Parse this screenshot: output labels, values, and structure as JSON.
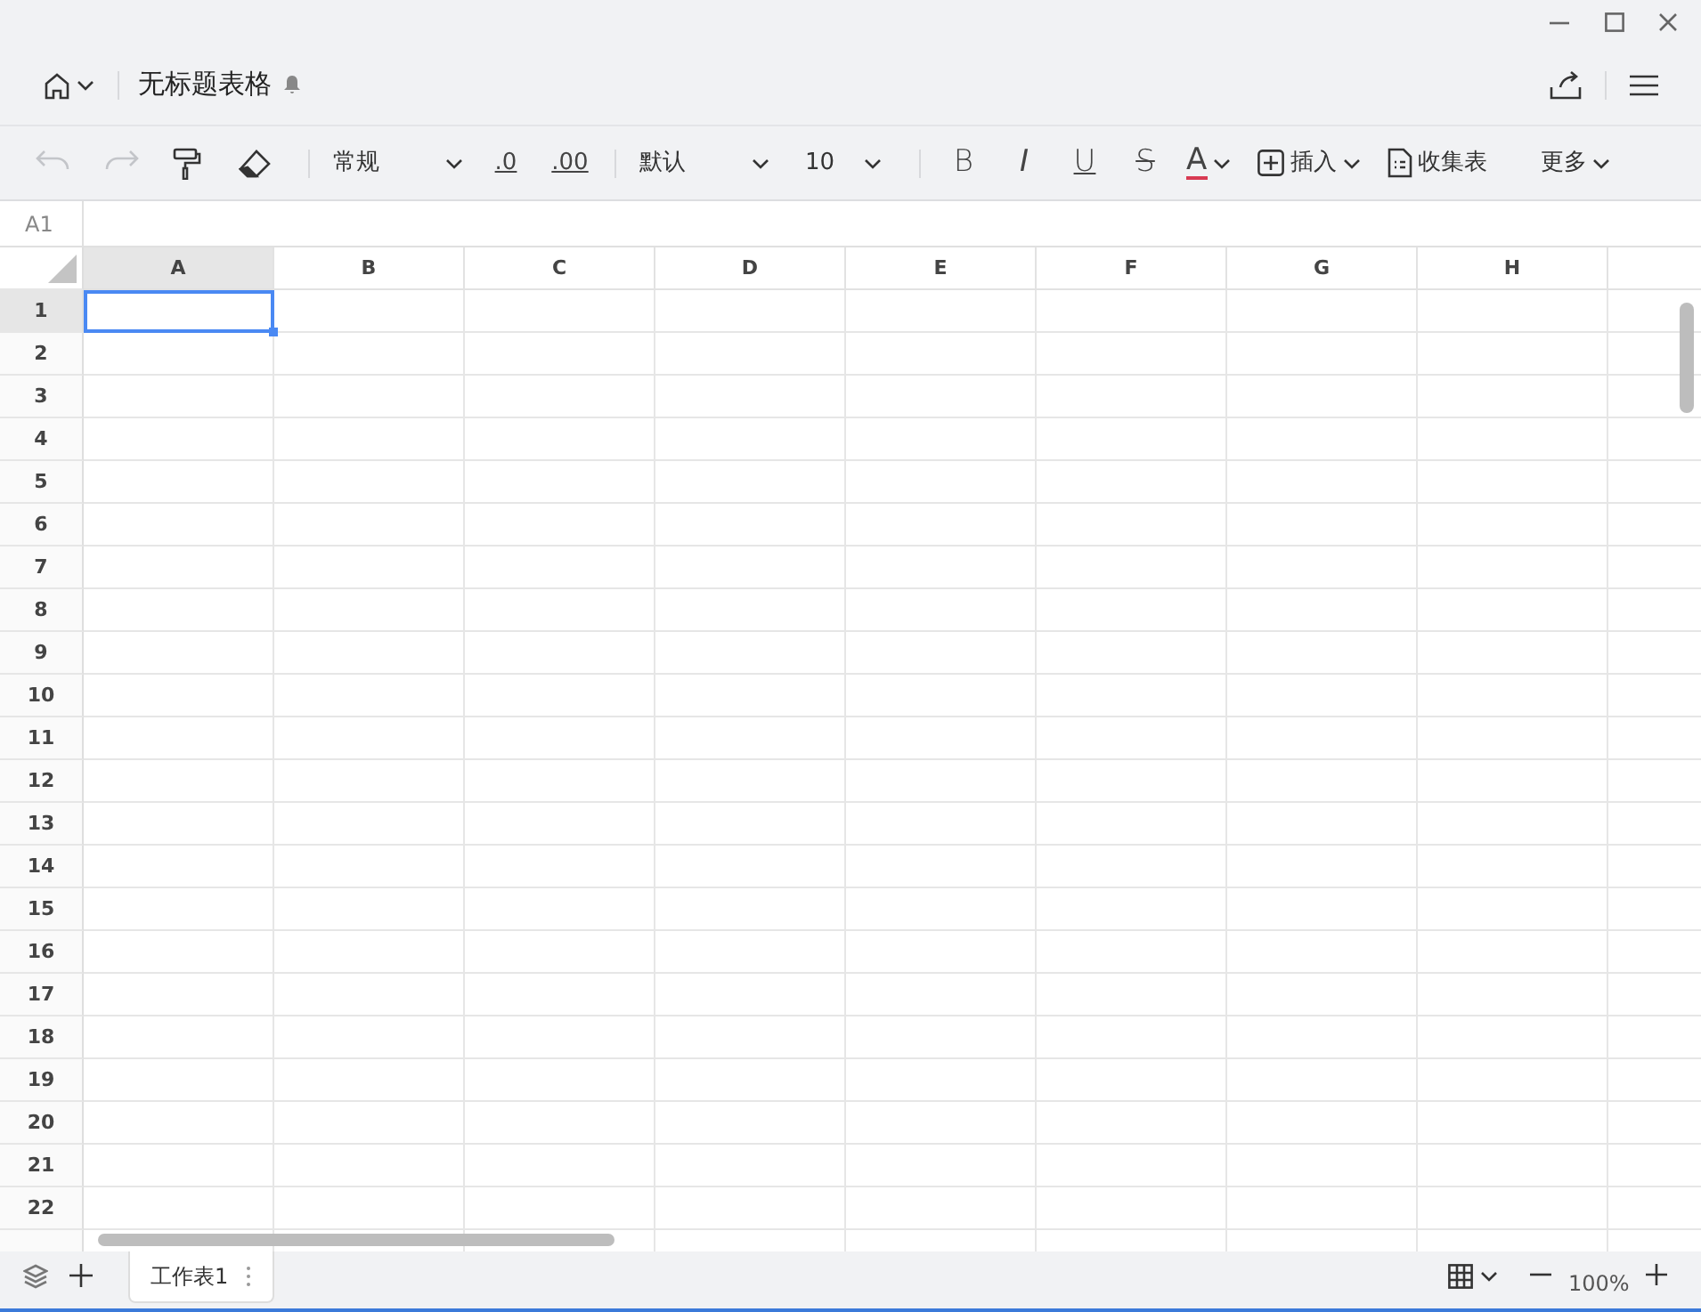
{
  "title": "无标题表格",
  "toolbar": [
    {
      "kind": "undo",
      "disabled": true
    },
    {
      "kind": "redo",
      "disabled": true
    },
    {
      "kind": "painter",
      "disabled": false
    },
    {
      "kind": "eraser",
      "disabled": false
    },
    {
      "kind": "sep"
    },
    {
      "kind": "select",
      "label": "常规"
    },
    {
      "kind": "decimal",
      "label": ".0"
    },
    {
      "kind": "decimal",
      "label": ".00"
    },
    {
      "kind": "sep"
    },
    {
      "kind": "select",
      "label": "默认"
    },
    {
      "kind": "select",
      "label": "10",
      "narrow": true
    },
    {
      "kind": "sep"
    },
    {
      "kind": "bold",
      "label": "B"
    },
    {
      "kind": "italic",
      "label": "I"
    },
    {
      "kind": "underline",
      "label": "U"
    },
    {
      "kind": "strike",
      "label": "S"
    },
    {
      "kind": "fontcolor",
      "label": "A"
    },
    {
      "kind": "insert",
      "label": "插入"
    },
    {
      "kind": "form",
      "label": "收集表"
    },
    {
      "kind": "more",
      "label": "更多"
    }
  ],
  "name_box": "A1",
  "columns": [
    {
      "label": "A",
      "selected": true
    },
    {
      "label": "B",
      "selected": false
    },
    {
      "label": "C",
      "selected": false
    },
    {
      "label": "D",
      "selected": false
    },
    {
      "label": "E",
      "selected": false
    },
    {
      "label": "F",
      "selected": false
    },
    {
      "label": "G",
      "selected": false
    },
    {
      "label": "H",
      "selected": false
    }
  ],
  "rows": [
    {
      "label": "1",
      "selected": true
    },
    {
      "label": "2",
      "selected": false
    },
    {
      "label": "3",
      "selected": false
    },
    {
      "label": "4",
      "selected": false
    },
    {
      "label": "5",
      "selected": false
    },
    {
      "label": "6",
      "selected": false
    },
    {
      "label": "7",
      "selected": false
    },
    {
      "label": "8",
      "selected": false
    },
    {
      "label": "9",
      "selected": false
    },
    {
      "label": "10",
      "selected": false
    },
    {
      "label": "11",
      "selected": false
    },
    {
      "label": "12",
      "selected": false
    },
    {
      "label": "13",
      "selected": false
    },
    {
      "label": "14",
      "selected": false
    },
    {
      "label": "15",
      "selected": false
    },
    {
      "label": "16",
      "selected": false
    },
    {
      "label": "17",
      "selected": false
    },
    {
      "label": "18",
      "selected": false
    },
    {
      "label": "19",
      "selected": false
    },
    {
      "label": "20",
      "selected": false
    },
    {
      "label": "21",
      "selected": false
    },
    {
      "label": "22",
      "selected": false
    }
  ],
  "sheets": [
    {
      "label": "工作表1",
      "selected": true
    }
  ],
  "zoom": "100%"
}
